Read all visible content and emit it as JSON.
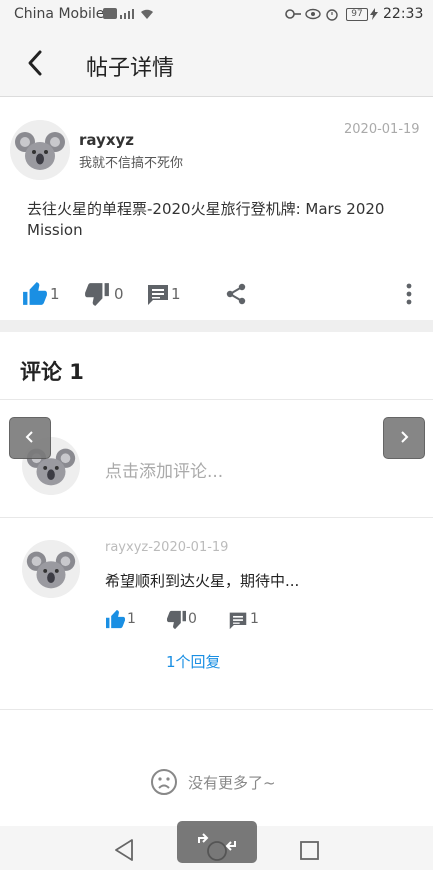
{
  "status_bar": {
    "carrier": "China Mobile",
    "battery": "97",
    "time": "22:33"
  },
  "header": {
    "title": "帖子详情"
  },
  "post": {
    "author": "rayxyz",
    "signature": "我就不信搞不死你",
    "date": "2020-01-19",
    "text": "去往火星的单程票-2020火星旅行登机牌: Mars 2020 Mission",
    "likes": "1",
    "dislikes": "0",
    "comments": "1"
  },
  "comments_section": {
    "title": "评论 1",
    "add_placeholder": "点击添加评论...",
    "items": [
      {
        "meta": "rayxyz-2020-01-19",
        "text": "希望顺利到达火星，期待中...",
        "likes": "1",
        "dislikes": "0",
        "comments": "1",
        "replies_label": "1个回复"
      }
    ]
  },
  "footer": {
    "no_more": "没有更多了~"
  },
  "colors": {
    "accent": "#1a8fe3",
    "icon_gray": "#5f6368"
  }
}
